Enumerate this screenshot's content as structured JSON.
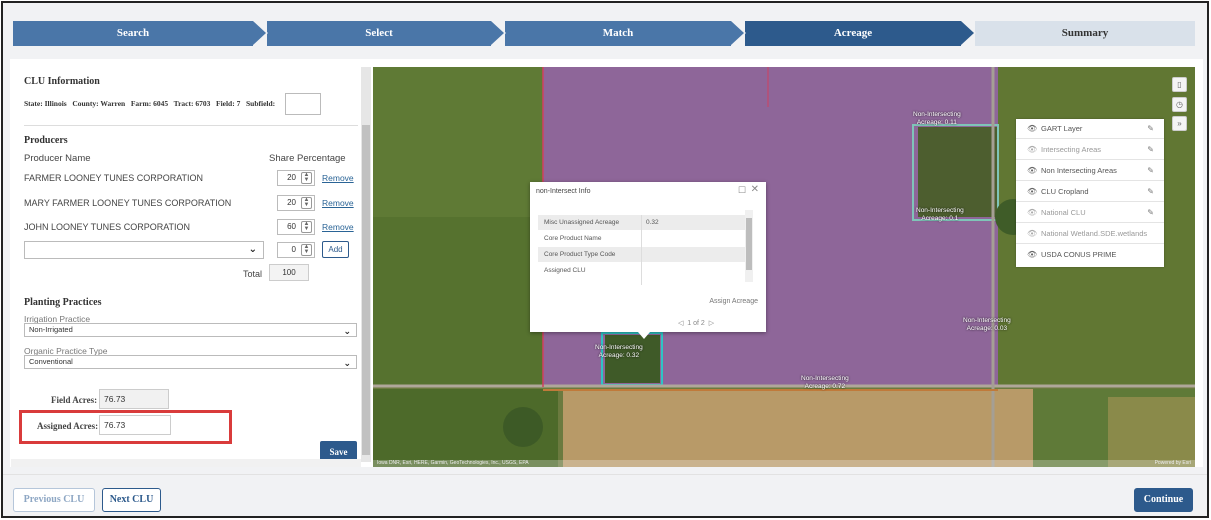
{
  "steps": [
    "Search",
    "Select",
    "Match",
    "Acreage",
    "Summary"
  ],
  "clu": {
    "title": "CLU Information",
    "state_label": "State:",
    "state": "Illinois",
    "county_label": "County:",
    "county": "Warren",
    "farm_label": "Farm:",
    "farm": "6045",
    "tract_label": "Tract:",
    "tract": "6703",
    "field_label": "Field:",
    "field": "7",
    "subfield_label": "Subfield:",
    "subfield_value": ""
  },
  "producers": {
    "title": "Producers",
    "col_name": "Producer Name",
    "col_share": "Share Percentage",
    "rows": [
      {
        "name": "FARMER LOONEY TUNES CORPORATION",
        "share": "20",
        "action": "Remove"
      },
      {
        "name": "MARY FARMER LOONEY TUNES CORPORATION",
        "share": "20",
        "action": "Remove"
      },
      {
        "name": "JOHN LOONEY TUNES CORPORATION",
        "share": "60",
        "action": "Remove"
      }
    ],
    "new_share": "0",
    "add_label": "Add",
    "total_label": "Total",
    "total": "100"
  },
  "planting": {
    "title": "Planting Practices",
    "irrigation_label": "Irrigation Practice",
    "irrigation_value": "Non-Irrigated",
    "organic_label": "Organic Practice Type",
    "organic_value": "Conventional"
  },
  "acres": {
    "field_label": "Field Acres:",
    "field_value": "76.73",
    "assigned_label": "Assigned Acres:",
    "assigned_value": "76.73",
    "save_label": "Save"
  },
  "footer": {
    "prev": "Previous CLU",
    "next": "Next CLU",
    "continue": "Continue"
  },
  "layers": [
    {
      "name": "GART Layer",
      "editable": true
    },
    {
      "name": "Intersecting Areas",
      "editable": true
    },
    {
      "name": "Non Intersecting Areas",
      "editable": true
    },
    {
      "name": "CLU Cropland",
      "editable": true
    },
    {
      "name": "National CLU",
      "editable": true
    },
    {
      "name": "National Wetland.SDE.wetlands",
      "editable": false
    },
    {
      "name": "USDA CONUS PRIME",
      "editable": false
    }
  ],
  "popup": {
    "title": "non-Intersect Info",
    "rows": [
      {
        "k": "Misc Unassigned Acreage",
        "v": "0.32"
      },
      {
        "k": "Core Product Name",
        "v": ""
      },
      {
        "k": "Core Product Type Code",
        "v": ""
      },
      {
        "k": "Assigned CLU",
        "v": ""
      }
    ],
    "action": "Assign Acreage",
    "pager": "1 of 2"
  },
  "map_labels": {
    "l1_a": "Non-Intersecting",
    "l1_b": "Acreage: 0.11",
    "l2_a": "Non-Intersecting",
    "l2_b": "Acreage: 0.1",
    "l3_a": "Non-Intersecting",
    "l3_b": "Acreage: 0.03",
    "l4_a": "Non-Intersecting",
    "l4_b": "Acreage: 0.72",
    "l5_a": "Non-Intersecting",
    "l5_b": "Acreage: 0.32"
  },
  "attribution": "Iowa DNR, Esri, HERE, Garmin, GeoTechnologies, Inc., USGS, EPA",
  "powered": "Powered by Esri",
  "colors": {
    "primary": "#2d5a8c",
    "highlight_box": "#d93b3b",
    "parcel": "#9a6ea5"
  }
}
